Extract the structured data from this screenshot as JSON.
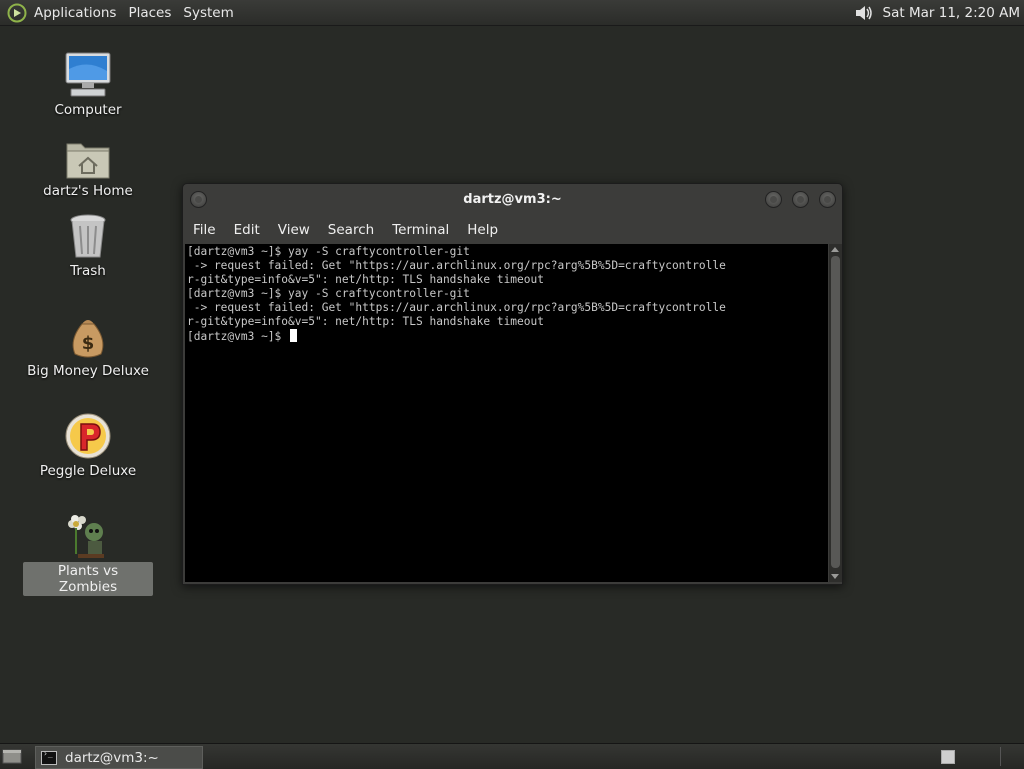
{
  "top_panel": {
    "menus": [
      "Applications",
      "Places",
      "System"
    ],
    "clock": "Sat Mar 11,  2:20 AM"
  },
  "desktop": {
    "icons": [
      {
        "label": "Computer",
        "icon": "computer-icon"
      },
      {
        "label": "dartz's Home",
        "icon": "home-folder-icon"
      },
      {
        "label": "Trash",
        "icon": "trash-icon"
      },
      {
        "label": "Big Money Deluxe",
        "icon": "money-bag-icon"
      },
      {
        "label": "Peggle Deluxe",
        "icon": "peggle-icon"
      },
      {
        "label": "Plants vs Zombies",
        "icon": "plants-vs-zombies-icon",
        "selected": true
      }
    ]
  },
  "terminal": {
    "title": "dartz@vm3:~",
    "menu": [
      "File",
      "Edit",
      "View",
      "Search",
      "Terminal",
      "Help"
    ],
    "lines": [
      "[dartz@vm3 ~]$ yay -S craftycontroller-git",
      " -> request failed: Get \"https://aur.archlinux.org/rpc?arg%5B%5D=craftycontrolle",
      "r-git&type=info&v=5\": net/http: TLS handshake timeout",
      "[dartz@vm3 ~]$ yay -S craftycontroller-git",
      " -> request failed: Get \"https://aur.archlinux.org/rpc?arg%5B%5D=craftycontrolle",
      "r-git&type=info&v=5\": net/http: TLS handshake timeout"
    ],
    "prompt": "[dartz@vm3 ~]$ "
  },
  "bottom_panel": {
    "task": "dartz@vm3:~"
  },
  "colors": {
    "desktop_bg": "#282a26",
    "terminal_bg": "#000000",
    "selection": "#6f716d"
  }
}
